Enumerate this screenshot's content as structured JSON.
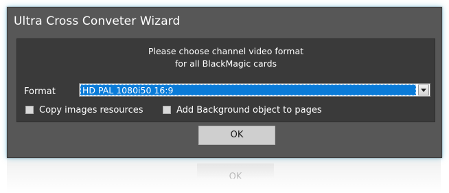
{
  "window": {
    "title": "Ultra Cross Conveter Wizard",
    "accent": "#0a7bd8"
  },
  "prompt": {
    "line1": "Please choose channel video format",
    "line2": "for all BlackMagic cards"
  },
  "format": {
    "label": "Format",
    "selected": "HD PAL 1080i50 16:9",
    "icon": "dropdown-arrow-icon"
  },
  "options": {
    "copy_images": {
      "label": "Copy images resources",
      "checked": false
    },
    "add_background": {
      "label": "Add Background object to pages",
      "checked": false
    }
  },
  "buttons": {
    "ok": "OK"
  }
}
